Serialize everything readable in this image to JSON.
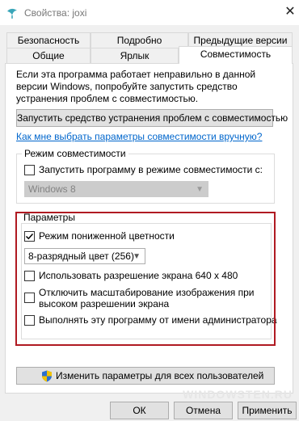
{
  "window": {
    "title": "Свойства: joxi",
    "close_glyph": "✕"
  },
  "tabs": {
    "row_back": [
      "Безопасность",
      "Подробно",
      "Предыдущие версии"
    ],
    "row_front": [
      "Общие",
      "Ярлык",
      "Совместимость"
    ],
    "active": "Совместимость"
  },
  "intro_text": "Если эта программа работает неправильно в данной версии Windows, попробуйте запустить средство устранения проблем с совместимостью.",
  "troubleshooter_button": "Запустить средство устранения проблем с совместимостью",
  "help_link": "Как мне выбрать параметры совместимости вручную?",
  "compat_mode": {
    "label": "Режим совместимости",
    "checkbox_label": "Запустить программу в режиме совместимости с:",
    "checked": false,
    "select_value": "Windows 8",
    "select_enabled": false
  },
  "settings": {
    "label": "Параметры",
    "reduced_color": {
      "label": "Режим пониженной цветности",
      "checked": true
    },
    "color_select": "8-разрядный цвет (256)",
    "res_640": {
      "label": "Использовать разрешение экрана 640 x 480",
      "checked": false
    },
    "disable_scaling": {
      "label_line1": "Отключить масштабирование изображения при",
      "label_line2": "высоком разрешении экрана",
      "checked": false
    },
    "run_as_admin": {
      "label": "Выполнять эту программу от имени администратора",
      "checked": false
    }
  },
  "change_all_users_button": "Изменить параметры для всех пользователей",
  "footer": {
    "ok": "ОК",
    "cancel": "Отмена",
    "apply": "Применить"
  },
  "colors": {
    "highlight_border": "#b01a22",
    "link": "#0066cc"
  },
  "watermark": "WINDOWSTEN.RU"
}
